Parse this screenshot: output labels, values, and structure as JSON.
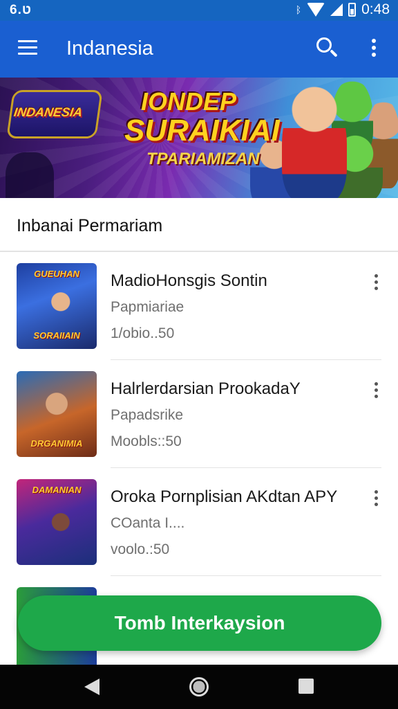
{
  "status_bar": {
    "left_text": "ט.6",
    "time": "0:48",
    "icons": [
      "bluetooth-icon",
      "wifi-icon",
      "signal-icon",
      "sim-icon",
      "battery-icon"
    ]
  },
  "app_bar": {
    "title": "Indanesia",
    "icons": [
      "menu-icon",
      "search-icon",
      "more-vert-icon"
    ]
  },
  "banner": {
    "logo_text": "INDANESIA",
    "title_line1": "IONDEP",
    "title_line2": "SURAIKIAI",
    "title_line3": "TPARIAMIZAN"
  },
  "section": {
    "title": "Inbanai Permariam"
  },
  "items": [
    {
      "title": "MadioHonsgis Sontin",
      "subtitle": "Papmiariae",
      "meta": "1/obio..50",
      "thumb_top": "GUEUHAN",
      "thumb_bottom": "SORAIIAIN"
    },
    {
      "title": "Halrlerdarsian ProokadaY",
      "subtitle": "Papadsrike",
      "meta": "Moobls::50",
      "thumb_top": "",
      "thumb_bottom": "DRGANIMIA"
    },
    {
      "title": "Oroka Pornplisian AKdtan APY",
      "subtitle": "COanta I....",
      "meta": "voolo.:50",
      "thumb_top": "DAMANIAN",
      "thumb_bottom": ""
    }
  ],
  "action_button": {
    "label": "Tomb Interkaysion",
    "color": "#1ea84a"
  },
  "colors": {
    "app_bar": "#1a5fd1",
    "status_bar": "#1565c0",
    "nav_bar": "#050505"
  }
}
